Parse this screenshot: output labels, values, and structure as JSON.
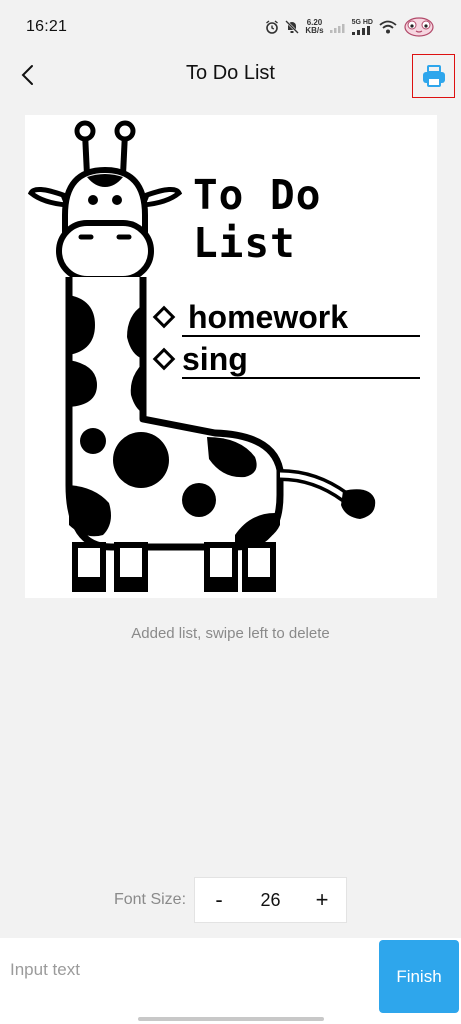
{
  "status_bar": {
    "time": "16:21",
    "net_speed_value": "6.20",
    "net_speed_unit": "KB/s",
    "network_label": "5G HD"
  },
  "header": {
    "title": "To Do List",
    "back_icon": "chevron-left-icon",
    "print_icon": "printer-icon",
    "accent_color": "#2ea6ec"
  },
  "preview": {
    "title": "To Do List",
    "items": [
      "homework",
      "sing"
    ],
    "illustration": "giraffe"
  },
  "hint": "Added list, swipe left to delete",
  "font_control": {
    "label": "Font Size:",
    "minus": "-",
    "value": "26",
    "plus": "+"
  },
  "input_bar": {
    "placeholder": "Input text",
    "value": "",
    "finish_label": "Finish"
  }
}
